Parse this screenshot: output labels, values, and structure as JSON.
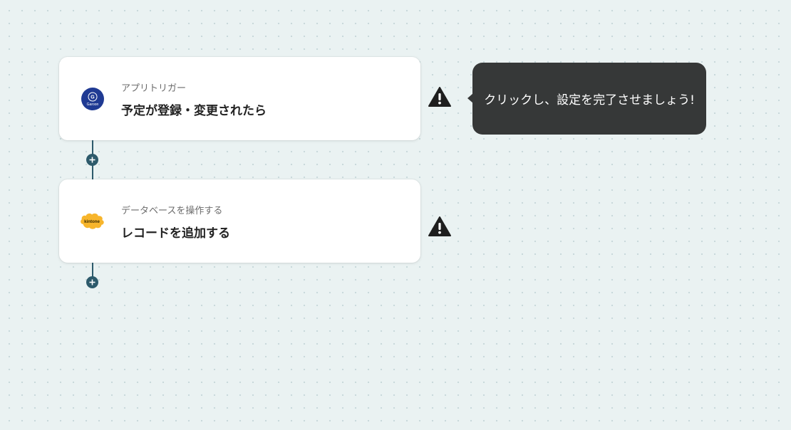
{
  "flow": {
    "steps": [
      {
        "category": "アプリトリガー",
        "title": "予定が登録・変更されたら",
        "app_logo": "garoon-logo",
        "app_logo_text": "Garoon",
        "status_icon": "warning-icon"
      },
      {
        "category": "データベースを操作する",
        "title": "レコードを追加する",
        "app_logo": "kintone-logo",
        "app_logo_text": "kintone",
        "status_icon": "warning-icon"
      }
    ],
    "add_step_icon": "plus-icon"
  },
  "tooltip": {
    "text": "クリックし、設定を完了させましょう!"
  },
  "colors": {
    "background": "#eaf2f2",
    "connector": "#2d5a6b",
    "tooltip_bg": "#363838",
    "garoon_blue": "#1f3a93",
    "kintone_yellow": "#f7b52c",
    "warning": "#1e1e1e"
  }
}
